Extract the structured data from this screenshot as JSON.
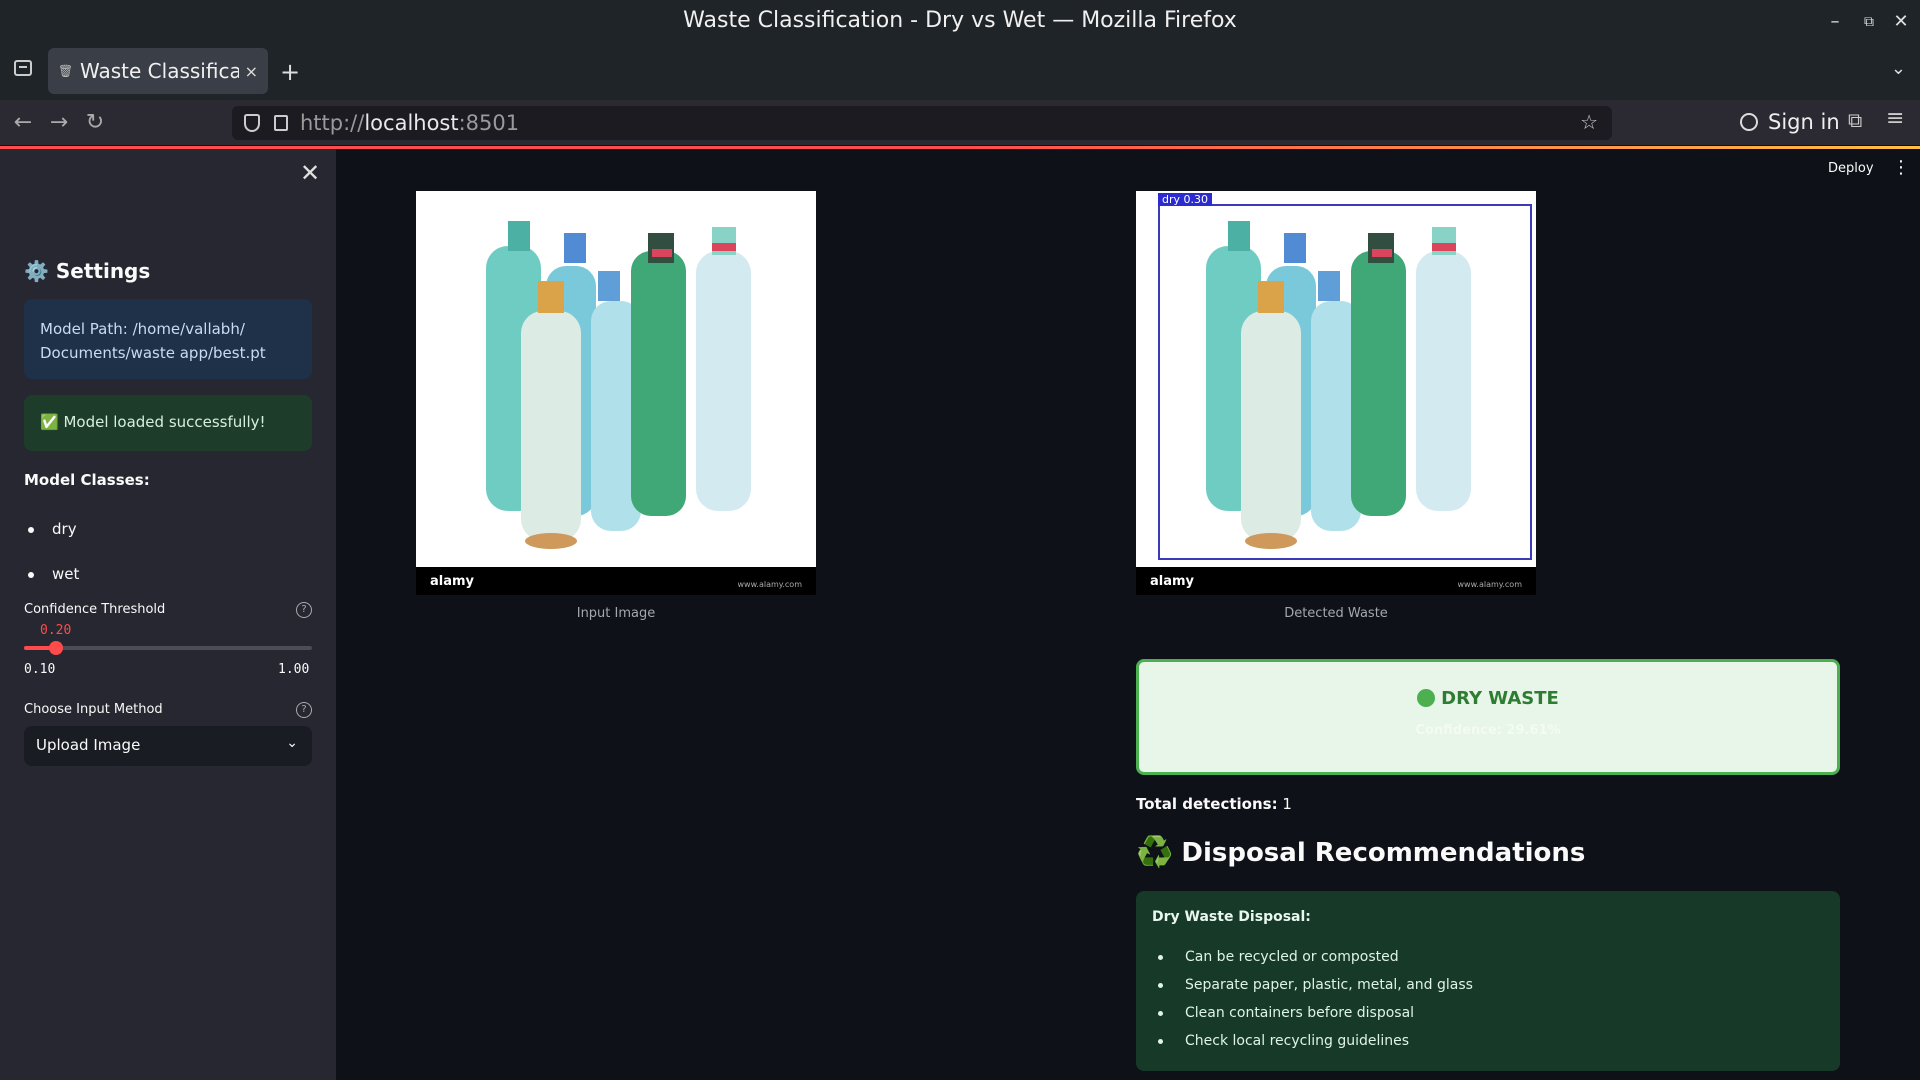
{
  "window": {
    "title": "Waste Classification - Dry vs Wet — Mozilla Firefox",
    "minimize": "–",
    "restore": "⧉",
    "close": "✕"
  },
  "tab": {
    "label": "Waste Classificati",
    "favicon": "wastebasket-icon",
    "close": "×",
    "new_tab": "+"
  },
  "navbar": {
    "url_scheme": "http://",
    "url_host": "localhost",
    "url_port": ":8501",
    "sign_in": "Sign in"
  },
  "sidebar": {
    "close": "✕",
    "settings_title": "Settings",
    "settings_icon": "⚙️",
    "model_path": "Model Path: /home/vallabh/ Documents/waste app/best.pt",
    "model_status": "✅ Model loaded successfully!",
    "classes_title": "Model Classes:",
    "classes": [
      "dry",
      "wet"
    ],
    "confidence_label": "Confidence Threshold",
    "confidence_value": "0.20",
    "confidence_fraction": 0.111,
    "slider_min": "0.10",
    "slider_max": "1.00",
    "method_label": "Choose Input Method",
    "method_selected": "Upload Image",
    "help": "?"
  },
  "main": {
    "deploy": "Deploy",
    "input_caption": "Input Image",
    "detected_caption": "Detected Waste",
    "image_brand": "alamy",
    "image_small": "www.alamy.com",
    "bbox_label": "dry  0.30",
    "result_title": "DRY WASTE",
    "result_confidence": "Confidence: 29.61%",
    "detections_label": "Total detections:",
    "detections_value": "1",
    "disposal_heading": "Disposal Recommendations",
    "disposal_icon": "♻️",
    "disposal_card_title": "Dry Waste Disposal:",
    "disposal_items": [
      "Can be recycled or composted",
      "Separate paper, plastic, metal, and glass",
      "Clean containers before disposal",
      "Check local recycling guidelines"
    ]
  },
  "colors": {
    "accent": "#ff4b4b",
    "success": "#4caf50",
    "sidebar_bg": "#262730",
    "main_bg": "#0e1117"
  }
}
